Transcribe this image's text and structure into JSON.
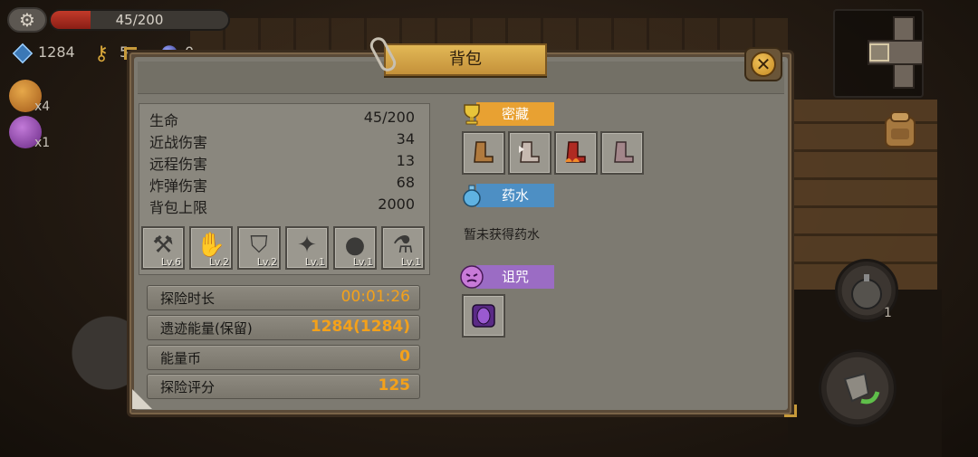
{
  "hud": {
    "hp_text": "45/200",
    "hp_fraction": 0.225,
    "energy": "1284",
    "keys": "5",
    "orbs": "0",
    "buffs": [
      {
        "count": "x4",
        "color": "#c9822e"
      },
      {
        "count": "x1",
        "color": "#9b3fb4"
      }
    ],
    "bomb_count": "1"
  },
  "panel": {
    "title": "背包",
    "close_icon": "close-x",
    "stats": [
      {
        "name": "生命",
        "value": "45/200"
      },
      {
        "name": "近战伤害",
        "value": "34"
      },
      {
        "name": "远程伤害",
        "value": "13"
      },
      {
        "name": "炸弹伤害",
        "value": "68"
      },
      {
        "name": "背包上限",
        "value": "2000"
      }
    ],
    "equipment": [
      {
        "icon": "hammer-icon",
        "glyph": "⚒",
        "level": "Lv.6"
      },
      {
        "icon": "gauntlet-icon",
        "glyph": "✋",
        "level": "Lv.2"
      },
      {
        "icon": "armor-icon",
        "glyph": "⛉",
        "level": "Lv.2"
      },
      {
        "icon": "shuriken-icon",
        "glyph": "✦",
        "level": "Lv.1"
      },
      {
        "icon": "bomb-icon",
        "glyph": "●",
        "level": "Lv.1"
      },
      {
        "icon": "potion-flask-icon",
        "glyph": "⚗",
        "level": "Lv.1"
      }
    ],
    "summary": [
      {
        "label": "探险时长",
        "value": "00:01:26"
      },
      {
        "label": "遗迹能量(保留)",
        "value": "1284(1284)"
      },
      {
        "label": "能量币",
        "value": "0"
      },
      {
        "label": "探险评分",
        "value": "125"
      }
    ],
    "sections": {
      "treasure": {
        "label": "密藏",
        "color": "#e8a132"
      },
      "potion": {
        "label": "药水",
        "color": "#4d8fc4",
        "empty_text": "暂未获得药水"
      },
      "curse": {
        "label": "诅咒",
        "color": "#9b6cc4"
      }
    }
  }
}
